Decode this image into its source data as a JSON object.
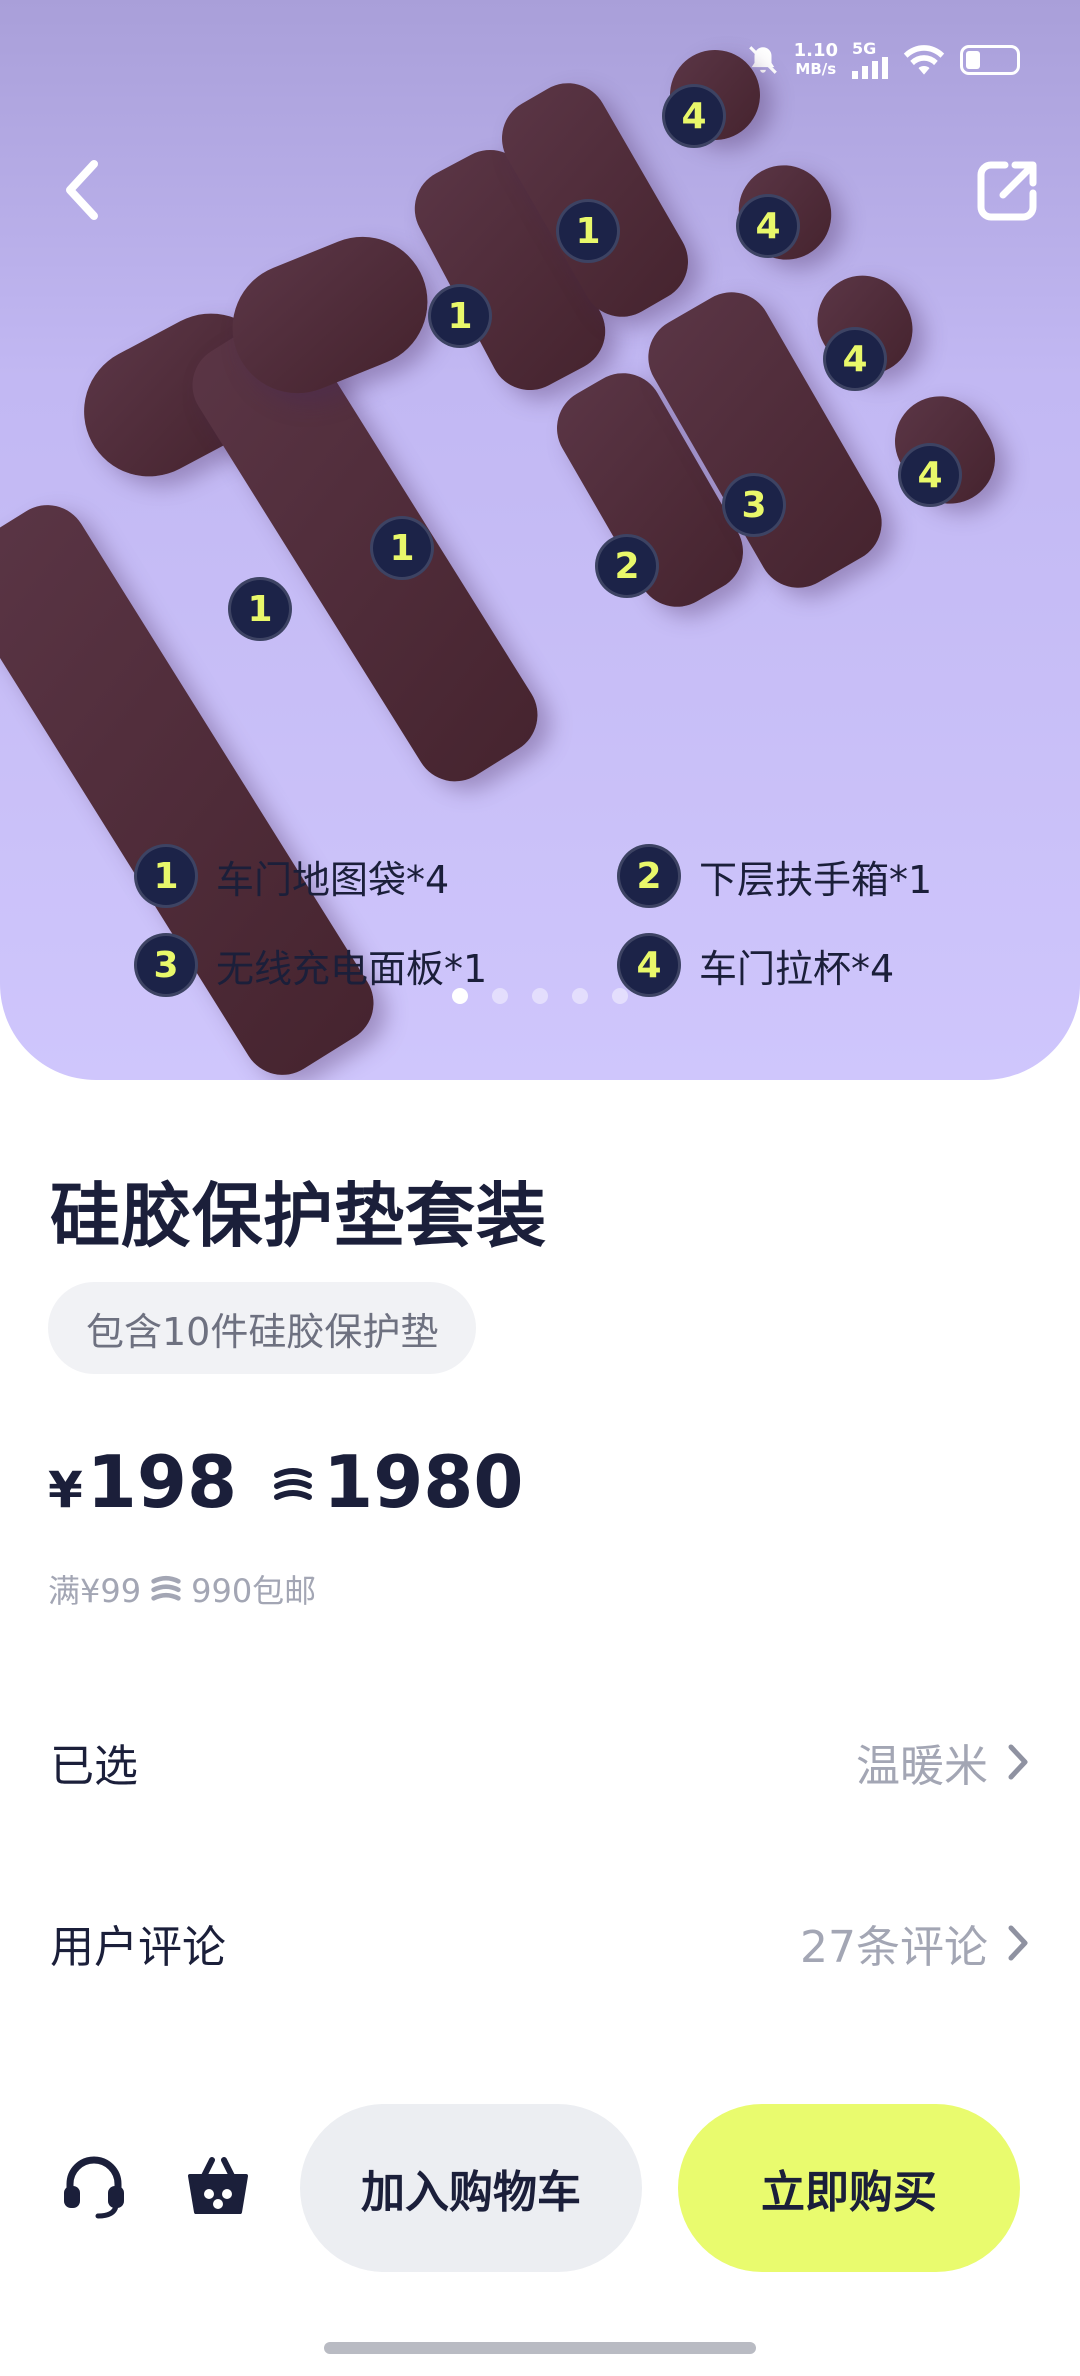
{
  "status_bar": {
    "speed": "1.10",
    "speed_unit": "MB/s",
    "network": "5G"
  },
  "hero": {
    "badges": [
      "1",
      "1",
      "1",
      "1",
      "2",
      "3",
      "4",
      "4",
      "4",
      "4"
    ],
    "legend": [
      {
        "num": "1",
        "text": "车门地图袋*4"
      },
      {
        "num": "2",
        "text": "下层扶手箱*1"
      },
      {
        "num": "3",
        "text": "无线充电面板*1"
      },
      {
        "num": "4",
        "text": "车门拉杯*4"
      }
    ],
    "carousel_total": 5,
    "carousel_active": 1
  },
  "product": {
    "title": "硅胶保护垫套装",
    "tag": "包含10件硅胶保护垫",
    "price_symbol": "¥",
    "price": "198",
    "coin_price": "1980",
    "shipping_prefix": "满¥99",
    "shipping_coin": "990包邮"
  },
  "selected": {
    "label": "已选",
    "value": "温暖米"
  },
  "reviews": {
    "label": "用户评论",
    "value": "27条评论"
  },
  "actions": {
    "add_to_cart": "加入购物车",
    "buy_now": "立即购买"
  },
  "colors": {
    "accent": "#e9fb6e",
    "badge_bg": "#1c2348",
    "badge_text": "#e9f86a",
    "hero_bg": "#cfc6fc"
  }
}
